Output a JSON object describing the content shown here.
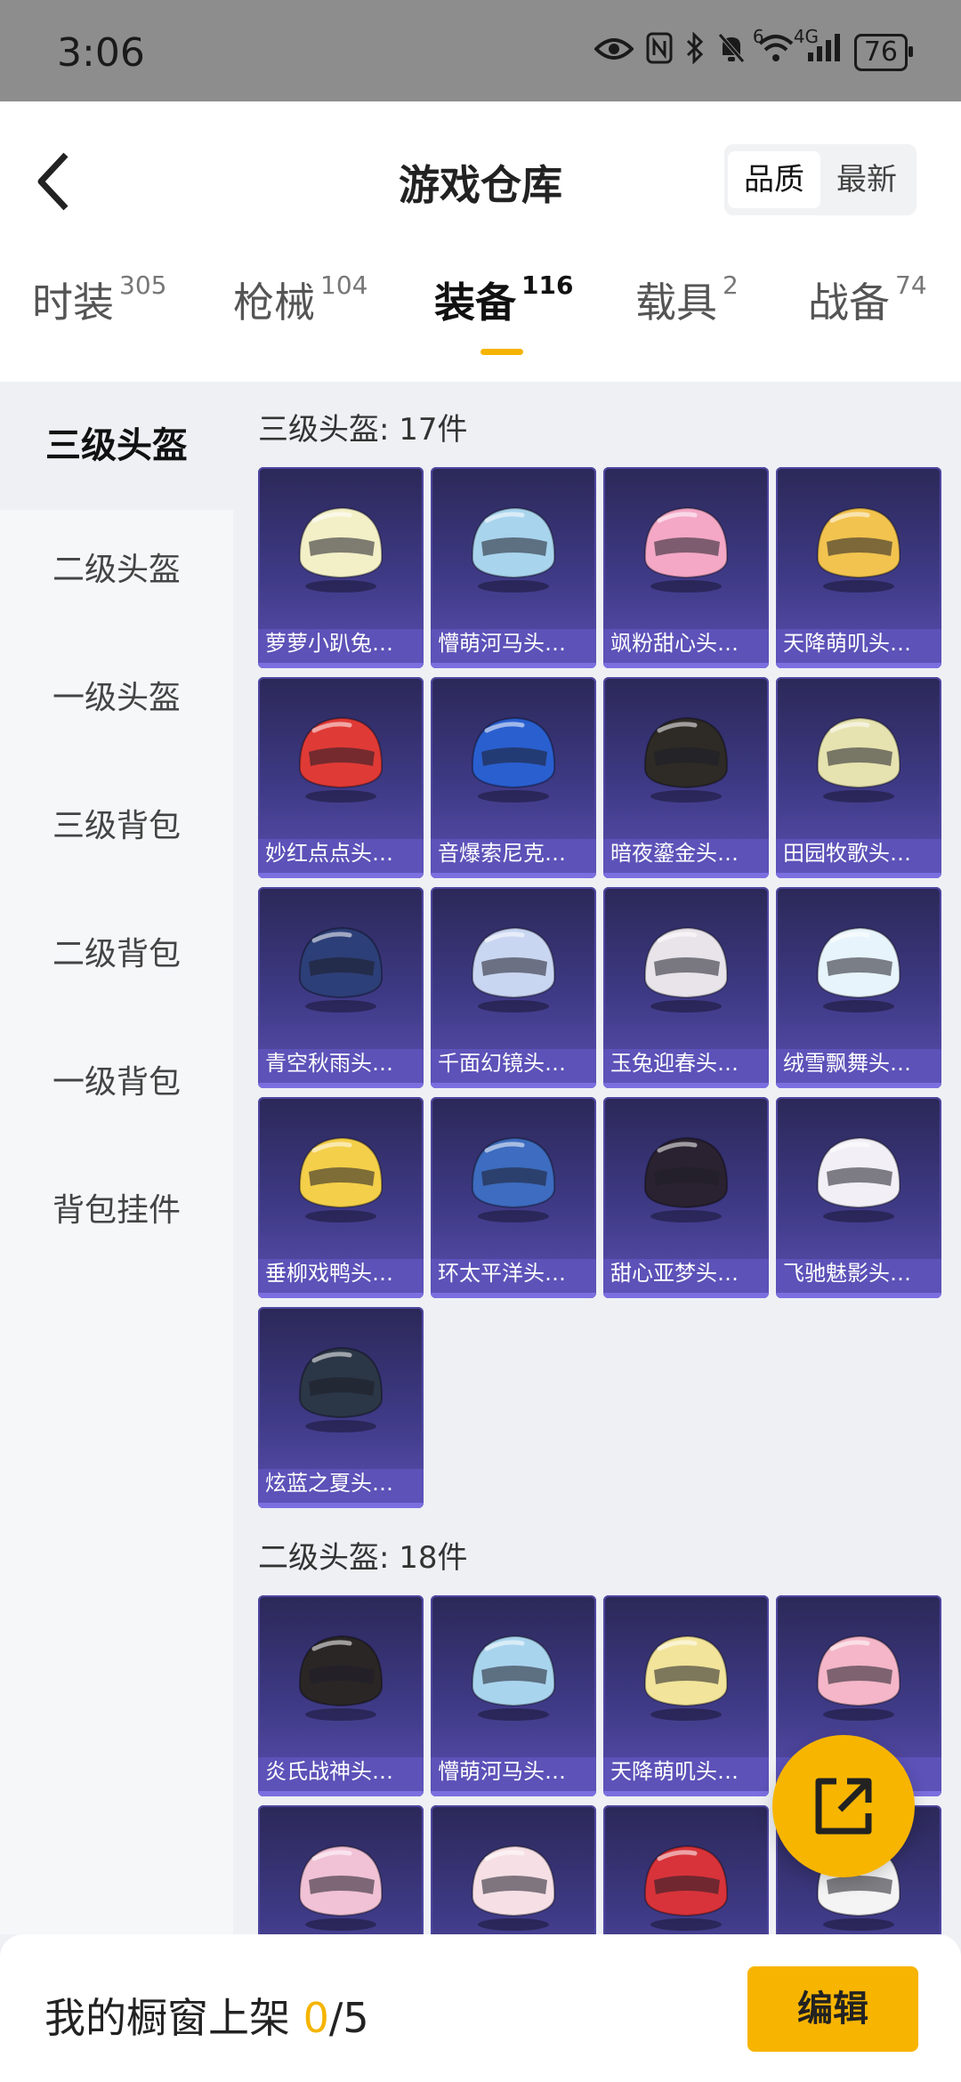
{
  "status_bar": {
    "time": "3:06",
    "icons": [
      "eye-icon",
      "nfc-icon",
      "bluetooth-icon",
      "mute-icon",
      "wifi-icon",
      "signal-icon"
    ],
    "wifi_label": "6",
    "signal_label": "4G",
    "battery": "76"
  },
  "header": {
    "title": "游戏仓库",
    "sort": {
      "quality": "品质",
      "newest": "最新"
    }
  },
  "tabs": [
    {
      "label": "时装",
      "count": "305"
    },
    {
      "label": "枪械",
      "count": "104"
    },
    {
      "label": "装备",
      "count": "116"
    },
    {
      "label": "载具",
      "count": "2"
    },
    {
      "label": "战备",
      "count": "74"
    }
  ],
  "sidebar": {
    "items": [
      {
        "label": "三级头盔"
      },
      {
        "label": "二级头盔"
      },
      {
        "label": "一级头盔"
      },
      {
        "label": "三级背包"
      },
      {
        "label": "二级背包"
      },
      {
        "label": "一级背包"
      },
      {
        "label": "背包挂件"
      }
    ]
  },
  "sections": [
    {
      "title": "三级头盔: 17件",
      "items": [
        {
          "name": "萝萝小趴兔…",
          "color": "#f3f0c8"
        },
        {
          "name": "懵萌河马头…",
          "color": "#a9d4ee"
        },
        {
          "name": "飒粉甜心头…",
          "color": "#f4a8c6"
        },
        {
          "name": "天降萌叽头…",
          "color": "#f2c34e"
        },
        {
          "name": "妙红点点头…",
          "color": "#e03a36"
        },
        {
          "name": "音爆索尼克…",
          "color": "#2a5fd0"
        },
        {
          "name": "暗夜鎏金头…",
          "color": "#2e2a26"
        },
        {
          "name": "田园牧歌头…",
          "color": "#e6e3b0"
        },
        {
          "name": "青空秋雨头…",
          "color": "#2d3f78"
        },
        {
          "name": "千面幻镜头…",
          "color": "#c9d6f2"
        },
        {
          "name": "玉兔迎春头…",
          "color": "#e8e4ea"
        },
        {
          "name": "绒雪飘舞头…",
          "color": "#e8f4fb"
        },
        {
          "name": "垂柳戏鸭头…",
          "color": "#f4cf4a"
        },
        {
          "name": "环太平洋头…",
          "color": "#3d6cc0"
        },
        {
          "name": "甜心亚梦头…",
          "color": "#2a2230"
        },
        {
          "name": "飞驰魅影头…",
          "color": "#f2f0f6"
        },
        {
          "name": "炫蓝之夏头…",
          "color": "#2b3646"
        }
      ]
    },
    {
      "title": "二级头盔: 18件",
      "items": [
        {
          "name": "炎氏战神头…",
          "color": "#2a2626"
        },
        {
          "name": "懵萌河马头…",
          "color": "#a9d4ee"
        },
        {
          "name": "天降萌叽头…",
          "color": "#f2e49a"
        },
        {
          "name": "",
          "color": "#f4b6c8"
        },
        {
          "name": "",
          "color": "#f1c2d6"
        },
        {
          "name": "",
          "color": "#f6e0e6"
        },
        {
          "name": "",
          "color": "#d8333a"
        },
        {
          "name": "",
          "color": "#f4f4f4"
        }
      ]
    }
  ],
  "bottom_bar": {
    "label": "我的橱窗上架",
    "current": "0",
    "separator": "/5",
    "edit_label": "编辑"
  }
}
